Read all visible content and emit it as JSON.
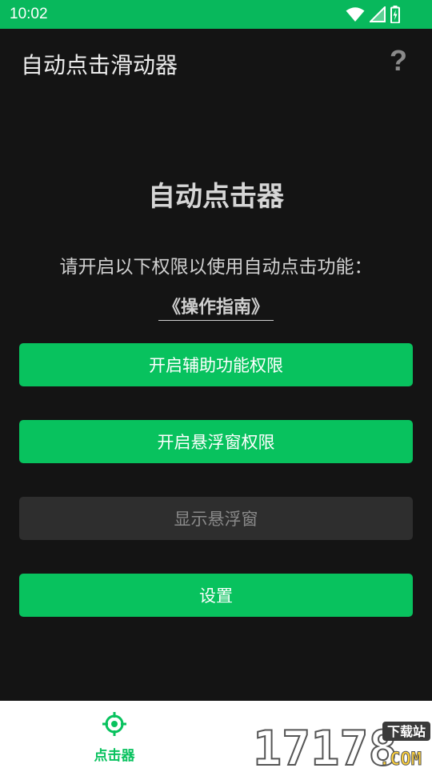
{
  "status_bar": {
    "time": "10:02"
  },
  "app_bar": {
    "title": "自动点击滑动器",
    "help_symbol": "?"
  },
  "main": {
    "heading": "自动点击器",
    "instruction": "请开启以下权限以使用自动点击功能：",
    "guide_link": "《操作指南》"
  },
  "buttons": {
    "accessibility": "开启辅助功能权限",
    "overlay_permission": "开启悬浮窗权限",
    "show_overlay": "显示悬浮窗",
    "settings": "设置"
  },
  "bottom_nav": {
    "items": [
      {
        "label": "点击器",
        "icon": "crosshair-icon",
        "active": true
      }
    ]
  },
  "watermark": {
    "number": "17178",
    "badge": "下载站",
    "suffix": ".COM"
  },
  "colors": {
    "accent": "#08c25e",
    "status_bar": "#08b85c",
    "background": "#141414",
    "disabled_button": "#2e2e2e"
  }
}
